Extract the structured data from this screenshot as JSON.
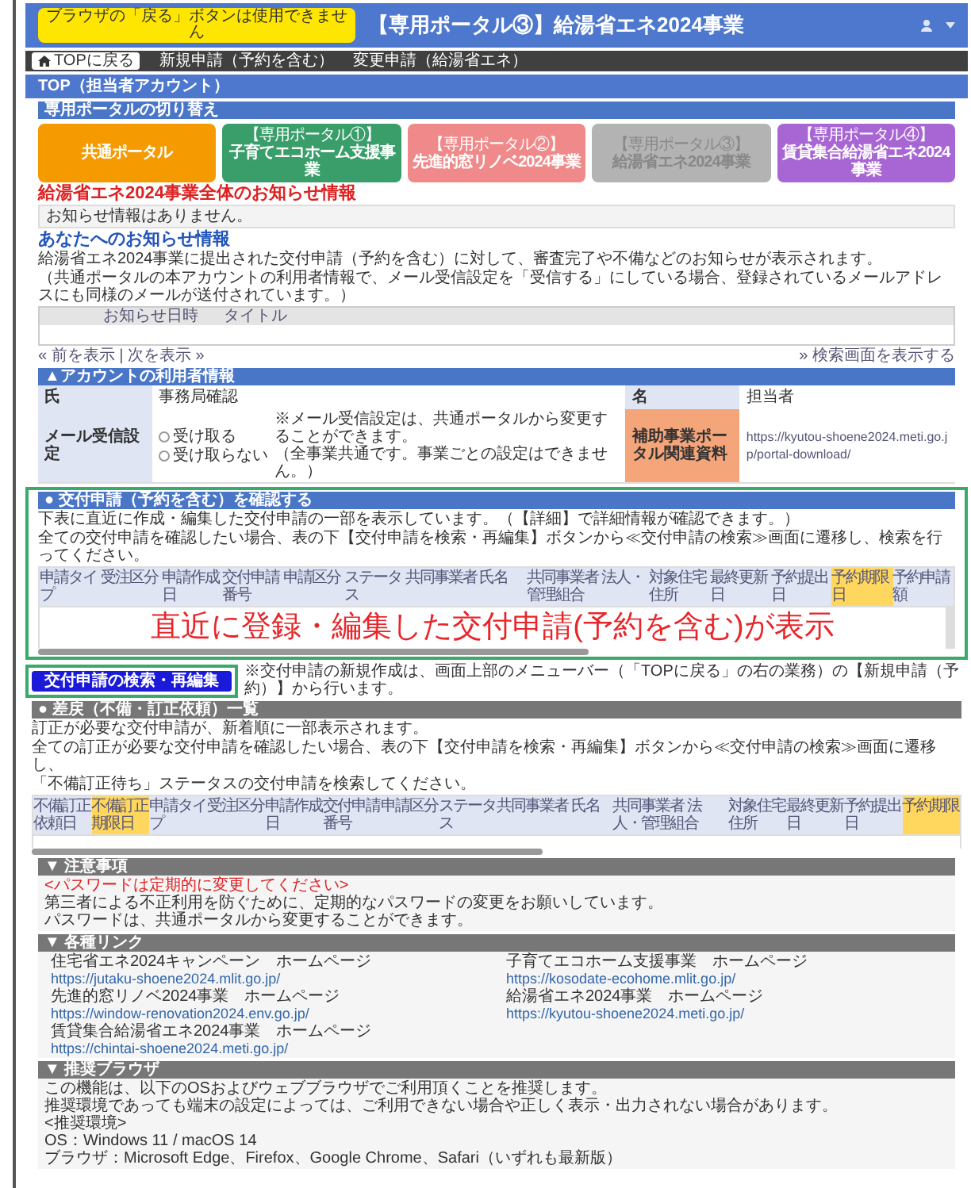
{
  "header": {
    "badge": "ブラウザの「戻る」ボタンは使用できません",
    "title": "【専用ポータル③】給湯省エネ2024事業"
  },
  "nav": [
    {
      "label": "TOPに戻る",
      "kind": "home"
    },
    {
      "label": "新規申請（予約を含む）",
      "kind": "menu"
    },
    {
      "label": "変更申請（給湯省エネ）",
      "kind": "menu"
    }
  ],
  "page_title": "TOP（担当者アカウント）",
  "portal_switch": {
    "title": "専用ポータルの切り替え",
    "buttons": [
      {
        "label": "共通ポータル",
        "color": "#f59a00",
        "disabled": false
      },
      {
        "sub": "【専用ポータル①】",
        "label": "子育てエコホーム支援事業",
        "color": "#3a9e6a",
        "disabled": false
      },
      {
        "sub": "【専用ポータル②】",
        "label": "先進的窓リノベ2024事業",
        "color": "#f08a8a",
        "disabled": false
      },
      {
        "sub": "【専用ポータル③】",
        "label": "給湯省エネ2024事業",
        "color": "#b3b3b3",
        "disabled": true
      },
      {
        "sub": "【専用ポータル④】",
        "label": "賃貸集合給湯省エネ2024事業",
        "color": "#a866d4",
        "disabled": false
      }
    ]
  },
  "project_notices": {
    "title": "給湯省エネ2024事業全体のお知らせ情報",
    "empty": "お知らせ情報はありません。"
  },
  "my_notices": {
    "title": "あなたへのお知らせ情報",
    "description": [
      "給湯省エネ2024事業に提出された交付申請（予約を含む）に対して、審査完了や不備などのお知らせが表示されます。",
      "（共通ポータルの本アカウントの利用者情報で、メール受信設定を「受信する」にしている場合、登録されているメールアドレスにも同様のメールが送付されています。）"
    ],
    "columns": [
      "お知らせ日時",
      "タイトル"
    ],
    "pager": "« 前を表示 | 次を表示 »",
    "more_link": "» 検索画面を表示する"
  },
  "account": {
    "title": "▲アカウントの利用者情報",
    "fields": [
      {
        "label": "氏",
        "value": "事務局確認"
      },
      {
        "label": "名",
        "value": "担当者"
      }
    ],
    "mail_setting": {
      "label": "メール受信設定",
      "options": [
        {
          "label": "受け取る",
          "selected": false
        },
        {
          "label": "受け取らない",
          "selected": false
        }
      ],
      "note": [
        "※メール受信設定は、共通ポータルから変更することができます。",
        "（全事業共通です。事業ごとの設定はできません。）"
      ]
    },
    "documents": {
      "label": "補助事業ポータル関連資料",
      "url": "https://kyutou-shoene2024.meti.go.jp/portal-download/"
    }
  },
  "applications": {
    "title": "● 交付申請（予約を含む）を確認する",
    "description": [
      "下表に直近に作成・編集した交付申請の一部を表示しています。（【詳細】で詳細情報が確認できます。）",
      "全ての交付申請を確認したい場合、表の下【交付申請を検索・再編集】ボタンから≪交付申請の検索≫画面に遷移し、検索を行ってください。"
    ],
    "columns": [
      {
        "label": "申請タイプ",
        "highlighted": false
      },
      {
        "label": "受注区分",
        "highlighted": false
      },
      {
        "label": "申請作成日",
        "highlighted": false
      },
      {
        "label": "交付申請番号",
        "highlighted": false
      },
      {
        "label": "申請区分",
        "highlighted": false
      },
      {
        "label": "ステータス",
        "highlighted": false
      },
      {
        "label": "共同事業者 氏名",
        "highlighted": false
      },
      {
        "label": "共同事業者 法人・管理組合",
        "highlighted": false
      },
      {
        "label": "対象住宅住所",
        "highlighted": false
      },
      {
        "label": "最終更新日",
        "highlighted": false
      },
      {
        "label": "予約提出日",
        "highlighted": false
      },
      {
        "label": "予約期限日",
        "highlighted": true
      },
      {
        "label": "予約申請額",
        "highlighted": false
      }
    ],
    "callout": "直近に登録・編集した交付申請(予約を含む)が表示",
    "button": "交付申請の検索・再編集",
    "note": "※交付申請の新規作成は、画面上部のメニューバー（「TOPに戻る」の右の業務）の【新規申請（予約）】から行います。"
  },
  "corrections": {
    "title": "● 差戻（不備・訂正依頼）一覧",
    "description": [
      "訂正が必要な交付申請が、新着順に一部表示されます。",
      "全ての訂正が必要な交付申請を確認したい場合、表の下【交付申請を検索・再編集】ボタンから≪交付申請の検索≫画面に遷移し、",
      "「不備訂正待ち」ステータスの交付申請を検索してください。"
    ],
    "columns": [
      {
        "label": "不備訂正依頼日",
        "highlighted": false
      },
      {
        "label": "不備訂正期限日",
        "highlighted": true
      },
      {
        "label": "申請タイプ",
        "highlighted": false
      },
      {
        "label": "受注区分",
        "highlighted": false
      },
      {
        "label": "申請作成日",
        "highlighted": false
      },
      {
        "label": "交付申請番号",
        "highlighted": false
      },
      {
        "label": "申請区分",
        "highlighted": false
      },
      {
        "label": "ステータス",
        "highlighted": false
      },
      {
        "label": "共同事業者 氏名",
        "highlighted": false
      },
      {
        "label": "共同事業者 法人・管理組合",
        "highlighted": false
      },
      {
        "label": "対象住宅住所",
        "highlighted": false
      },
      {
        "label": "最終更新日",
        "highlighted": false
      },
      {
        "label": "予約提出日",
        "highlighted": false
      },
      {
        "label": "予約期限",
        "highlighted": true
      }
    ]
  },
  "cautions": {
    "title": "▼ 注意事項",
    "lines": [
      {
        "text": "<パスワードは定期的に変更してください>",
        "kind": "alert"
      },
      {
        "text": "第三者による不正利用を防ぐために、定期的なパスワードの変更をお願いしています。",
        "kind": "plain"
      },
      {
        "text": "パスワードは、共通ポータルから変更することができます。",
        "kind": "plain"
      }
    ]
  },
  "links": {
    "title": "▼ 各種リンク",
    "items": [
      {
        "name": "住宅省エネ2024キャンペーン　ホームページ",
        "url": "https://jutaku-shoene2024.mlit.go.jp/"
      },
      {
        "name": "子育てエコホーム支援事業　ホームページ",
        "url": "https://kosodate-ecohome.mlit.go.jp/"
      },
      {
        "name": "先進的窓リノベ2024事業　ホームページ",
        "url": "https://window-renovation2024.env.go.jp/"
      },
      {
        "name": "給湯省エネ2024事業　ホームページ",
        "url": "https://kyutou-shoene2024.meti.go.jp/"
      },
      {
        "name": "賃貸集合給湯省エネ2024事業　ホームページ",
        "url": "https://chintai-shoene2024.meti.go.jp/"
      }
    ]
  },
  "browsers": {
    "title": "▼ 推奨ブラウザ",
    "lines": [
      "この機能は、以下のOSおよびウェブブラウザでご利用頂くことを推奨します。",
      "推奨環境であっても端末の設定によっては、ご利用できない場合や正しく表示・出力されない場合があります。",
      "<推奨環境>",
      "OS：Windows 11 / macOS 14",
      "ブラウザ：Microsoft Edge、Firefox、Google Chrome、Safari（いずれも最新版）"
    ]
  }
}
